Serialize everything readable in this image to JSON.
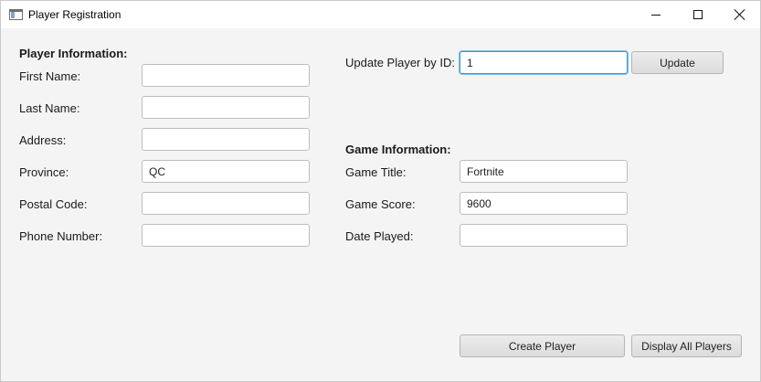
{
  "window": {
    "title": "Player Registration",
    "controls": {
      "minimize": "minimize-icon",
      "maximize": "maximize-icon",
      "close": "close-icon"
    }
  },
  "player_info": {
    "heading": "Player Information:",
    "fields": {
      "first_name": {
        "label": "First Name:",
        "value": ""
      },
      "last_name": {
        "label": "Last Name:",
        "value": ""
      },
      "address": {
        "label": "Address:",
        "value": ""
      },
      "province": {
        "label": "Province:",
        "value": "QC"
      },
      "postal_code": {
        "label": "Postal Code:",
        "value": ""
      },
      "phone_number": {
        "label": "Phone Number:",
        "value": ""
      }
    }
  },
  "update": {
    "label": "Update Player by ID:",
    "value": "1",
    "button": "Update"
  },
  "game_info": {
    "heading": "Game Information:",
    "fields": {
      "game_title": {
        "label": "Game Title:",
        "value": "Fortnite"
      },
      "game_score": {
        "label": "Game Score:",
        "value": "9600"
      },
      "date_played": {
        "label": "Date Played:",
        "value": ""
      }
    }
  },
  "actions": {
    "create": "Create Player",
    "display_all": "Display All Players"
  }
}
